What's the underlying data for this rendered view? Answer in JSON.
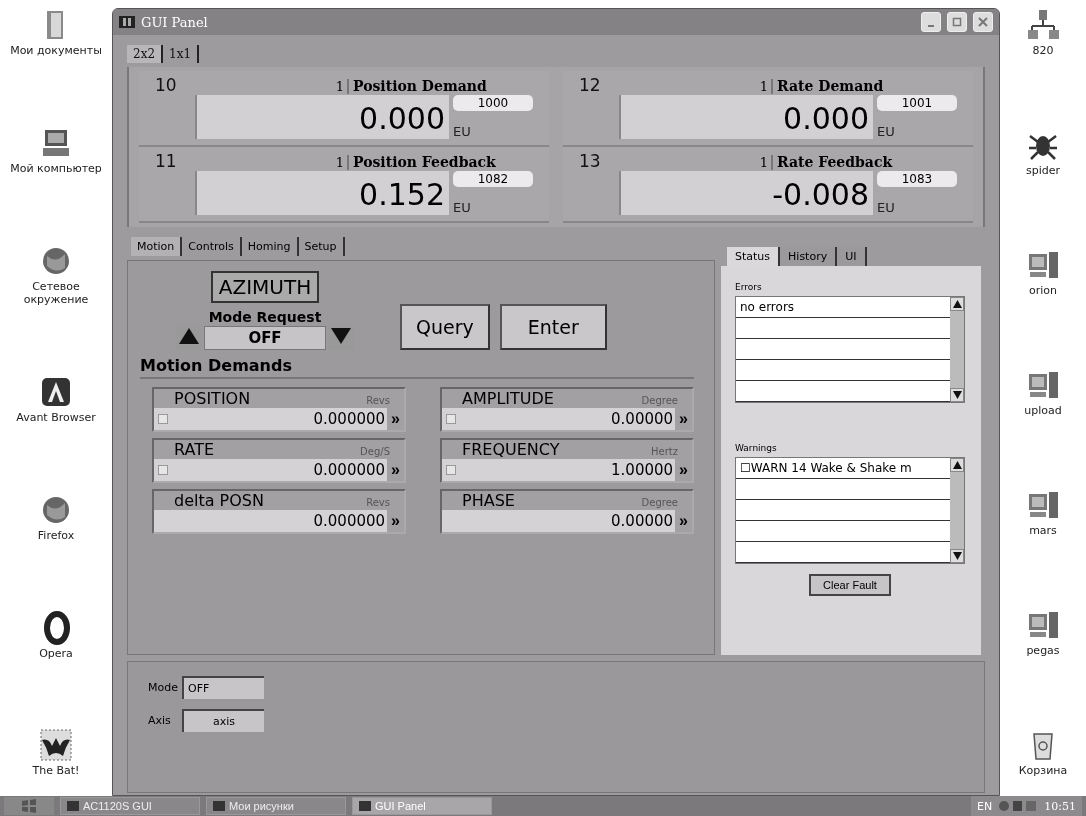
{
  "desktop_left": [
    {
      "label": "Мои документы",
      "kind": "folder"
    },
    {
      "label": "Мой компьютер",
      "kind": "computer"
    },
    {
      "label": "Сетевое окружение",
      "kind": "globe"
    },
    {
      "label": "Avant Browser",
      "kind": "app"
    },
    {
      "label": "Firefox",
      "kind": "globe"
    },
    {
      "label": "Opera",
      "kind": "ring"
    },
    {
      "label": "The Bat!",
      "kind": "bat"
    }
  ],
  "desktop_right": [
    {
      "label": "820",
      "kind": "network"
    },
    {
      "label": "spider",
      "kind": "bug"
    },
    {
      "label": "orion",
      "kind": "server"
    },
    {
      "label": "upload",
      "kind": "server"
    },
    {
      "label": "mars",
      "kind": "server"
    },
    {
      "label": "pegas",
      "kind": "server"
    },
    {
      "label": "Корзина",
      "kind": "trash"
    }
  ],
  "window": {
    "title": "GUI Panel"
  },
  "layout_tabs": [
    {
      "label": "2x2",
      "selected": true
    },
    {
      "label": "1x1",
      "selected": false
    }
  ],
  "readouts": [
    {
      "id": "10",
      "channel": "1",
      "name": "Position Demand",
      "value": "0.000",
      "unit": "EU",
      "code": "1000"
    },
    {
      "id": "12",
      "channel": "1",
      "name": "Rate Demand",
      "value": "0.000",
      "unit": "EU",
      "code": "1001"
    },
    {
      "id": "11",
      "channel": "1",
      "name": "Position Feedback",
      "value": "0.152",
      "unit": "EU",
      "code": "1082"
    },
    {
      "id": "13",
      "channel": "1",
      "name": "Rate Feedback",
      "value": "-0.008",
      "unit": "EU",
      "code": "1083"
    }
  ],
  "motion_tabs": [
    {
      "label": "Motion",
      "selected": true
    },
    {
      "label": "Controls",
      "selected": false
    },
    {
      "label": "Homing",
      "selected": false
    },
    {
      "label": "Setup",
      "selected": false
    }
  ],
  "axis_title": "AZIMUTH",
  "mode_request": {
    "label": "Mode Request",
    "value": "OFF"
  },
  "buttons": [
    "Query",
    "Enter"
  ],
  "demands_title": "Motion Demands",
  "demands": [
    {
      "label": "POSITION",
      "unit": "Revs",
      "value": "0.000000",
      "send": "»",
      "kind": "led"
    },
    {
      "label": "AMPLITUDE",
      "unit": "Degree",
      "value": "0.00000",
      "send": "»",
      "kind": "led"
    },
    {
      "label": "RATE",
      "unit": "Deg/S",
      "value": "0.000000",
      "send": "»",
      "kind": "led"
    },
    {
      "label": "FREQUENCY",
      "unit": "Hertz",
      "value": "1.00000",
      "send": "»",
      "kind": "led"
    },
    {
      "label": "delta POSN",
      "unit": "Revs",
      "value": "0.000000",
      "send": "»",
      "kind": "plain"
    },
    {
      "label": "PHASE",
      "unit": "Degree",
      "value": "0.00000",
      "send": "»",
      "kind": "plain"
    }
  ],
  "status_tabs": [
    {
      "label": "Status",
      "selected": true
    },
    {
      "label": "History",
      "selected": false
    },
    {
      "label": "UI",
      "selected": false
    }
  ],
  "errors": {
    "label": "Errors",
    "rows": [
      "no errors"
    ]
  },
  "warnings": {
    "label": "Warnings",
    "rows": [
      "☐WARN 14 Wake & Shake m"
    ]
  },
  "clear_button": "Clear Fault",
  "bottom_fields": [
    {
      "label": "Mode",
      "value": "OFF"
    },
    {
      "label": "Axis",
      "value": "axis"
    }
  ],
  "taskbar": {
    "tasks": [
      {
        "label": "AC1120S GUI",
        "selected": false
      },
      {
        "label": "Мои рисунки",
        "selected": false
      },
      {
        "label": "GUI Panel",
        "selected": true
      }
    ],
    "language": "EN",
    "time": "10:51"
  }
}
